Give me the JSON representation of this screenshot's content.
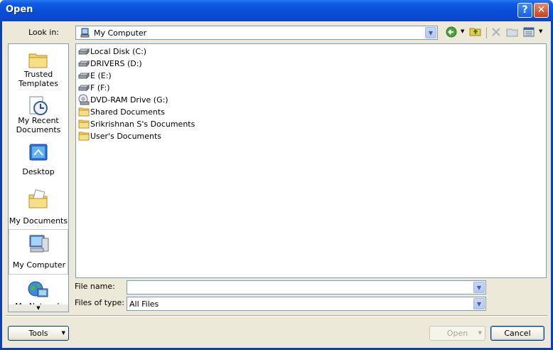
{
  "window": {
    "title": "Open"
  },
  "title_buttons": {
    "help": "?",
    "close": "✕"
  },
  "look_in": {
    "label": "Look in:",
    "value": "My Computer"
  },
  "places": [
    {
      "label": "Trusted Templates",
      "icon": "folder-icon"
    },
    {
      "label": "My Recent Documents",
      "icon": "recent-clock-icon"
    },
    {
      "label": "Desktop",
      "icon": "desktop-icon"
    },
    {
      "label": "My Documents",
      "icon": "my-documents-icon"
    },
    {
      "label": "My Computer",
      "icon": "computer-icon",
      "selected": true
    },
    {
      "label": "My Network",
      "icon": "network-globe-icon"
    }
  ],
  "files": [
    {
      "name": "Local Disk (C:)",
      "icon": "hard-drive-icon"
    },
    {
      "name": "DRIVERS (D:)",
      "icon": "hard-drive-icon"
    },
    {
      "name": "E (E:)",
      "icon": "hard-drive-icon"
    },
    {
      "name": "F (F:)",
      "icon": "hard-drive-icon"
    },
    {
      "name": "DVD-RAM Drive (G:)",
      "icon": "dvd-drive-icon"
    },
    {
      "name": "Shared Documents",
      "icon": "folder-icon"
    },
    {
      "name": "Srikrishnan S's Documents",
      "icon": "folder-icon"
    },
    {
      "name": "User's Documents",
      "icon": "folder-icon"
    }
  ],
  "file_name": {
    "label": "File name:",
    "value": ""
  },
  "files_of_type": {
    "label": "Files of type:",
    "value": "All Files"
  },
  "buttons": {
    "tools": "Tools",
    "open": "Open",
    "cancel": "Cancel"
  },
  "colors": {
    "title_bar": "#0a4cd6",
    "dialog_bg": "#ece9d8",
    "border": "#7f9db9"
  }
}
